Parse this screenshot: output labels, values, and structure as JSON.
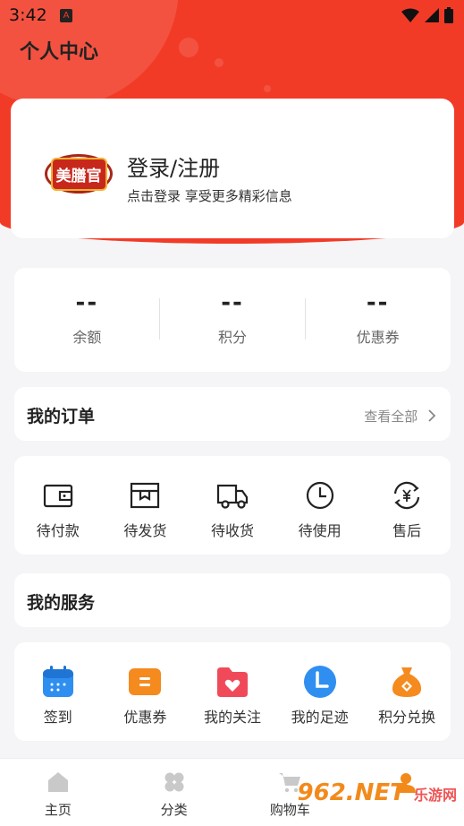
{
  "status": {
    "time": "3:42",
    "app_badge": "A"
  },
  "header": {
    "title": "个人中心"
  },
  "login": {
    "logo_text": "美膳官",
    "title": "登录/注册",
    "subtitle": "点击登录 享受更多精彩信息"
  },
  "stats": [
    {
      "value": "--",
      "label": "余额"
    },
    {
      "value": "--",
      "label": "积分"
    },
    {
      "value": "--",
      "label": "优惠券"
    }
  ],
  "orders": {
    "title": "我的订单",
    "see_all": "查看全部",
    "items": [
      {
        "label": "待付款",
        "icon": "wallet-icon"
      },
      {
        "label": "待发货",
        "icon": "package-icon"
      },
      {
        "label": "待收货",
        "icon": "truck-icon"
      },
      {
        "label": "待使用",
        "icon": "clock-icon"
      },
      {
        "label": "售后",
        "icon": "refund-icon"
      }
    ]
  },
  "services": {
    "title": "我的服务",
    "items": [
      {
        "label": "签到",
        "icon": "calendar-icon",
        "color": "#2f8ff0"
      },
      {
        "label": "优惠券",
        "icon": "coupon-icon",
        "color": "#f58a1f"
      },
      {
        "label": "我的关注",
        "icon": "heart-folder-icon",
        "color": "#f04a5a"
      },
      {
        "label": "我的足迹",
        "icon": "footprint-clock-icon",
        "color": "#2f8ff0"
      },
      {
        "label": "积分兑换",
        "icon": "money-bag-icon",
        "color": "#f58a1f"
      }
    ]
  },
  "tabbar": [
    {
      "label": "主页",
      "icon": "home-icon"
    },
    {
      "label": "分类",
      "icon": "category-icon"
    },
    {
      "label": "购物车",
      "icon": "cart-icon"
    },
    {
      "label": "",
      "icon": "profile-icon"
    }
  ],
  "watermark": {
    "text": "962.NET",
    "sub": "乐游网"
  },
  "colors": {
    "brand": "#f23b27"
  }
}
